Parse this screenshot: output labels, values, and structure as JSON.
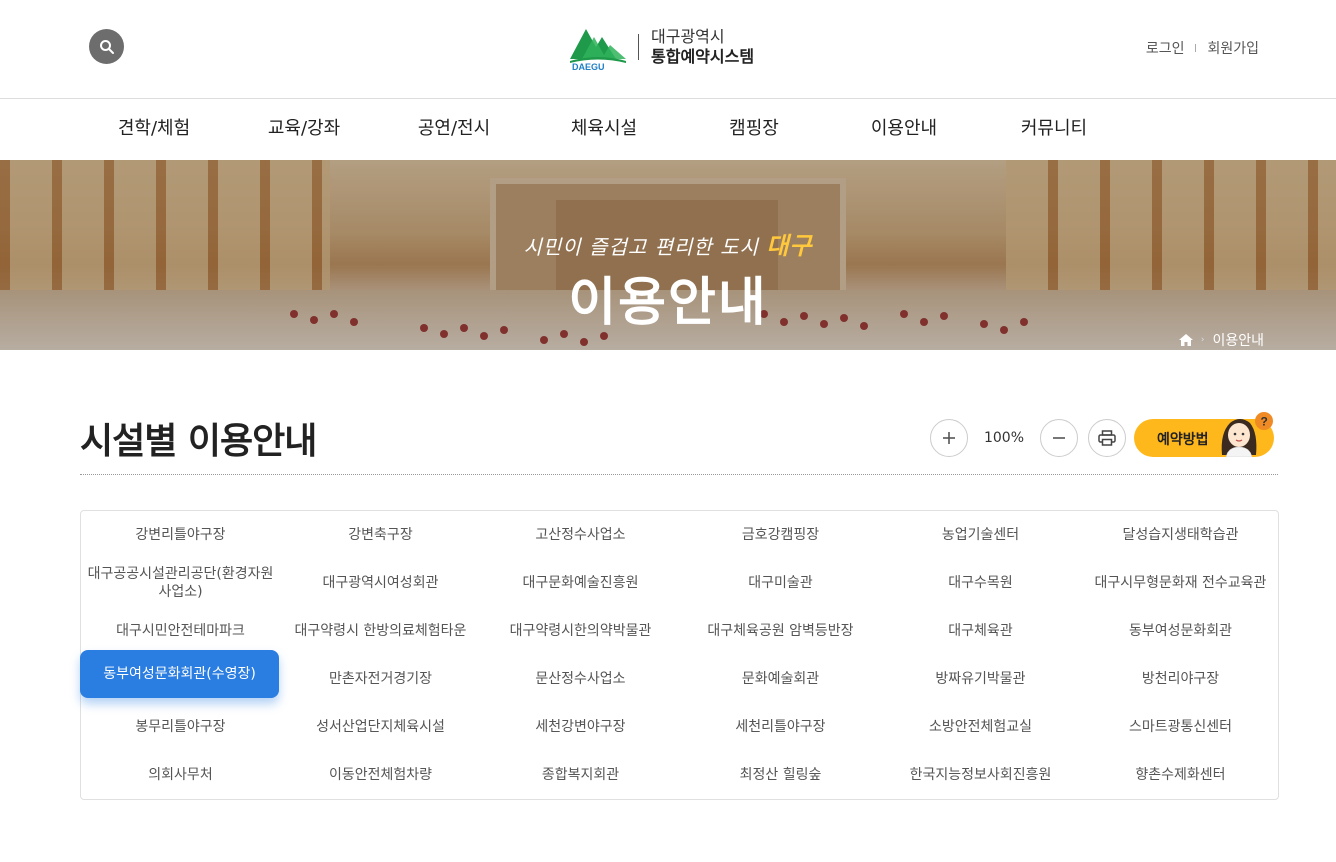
{
  "header": {
    "logo_small": "DAEGU",
    "logo_line1": "대구광역시",
    "logo_line2": "통합예약시스템",
    "login": "로그인",
    "join": "회원가입"
  },
  "gnb": [
    {
      "label": "견학/체험"
    },
    {
      "label": "교육/강좌"
    },
    {
      "label": "공연/전시"
    },
    {
      "label": "체육시설"
    },
    {
      "label": "캠핑장"
    },
    {
      "label": "이용안내"
    },
    {
      "label": "커뮤니티"
    }
  ],
  "visual": {
    "subtitle": "시민이 즐겁고 편리한 도시",
    "subtitle_accent": "대구",
    "title": "이용안내",
    "breadcrumb_current": "이용안내"
  },
  "content": {
    "title": "시설별 이용안내",
    "zoom": "100%",
    "guide_button": "예약방법"
  },
  "facilities": [
    [
      "강변리틀야구장",
      "강변축구장",
      "고산정수사업소",
      "금호강캠핑장",
      "농업기술센터",
      "달성습지생태학습관"
    ],
    [
      "대구공공시설관리공단(환경자원사업소)",
      "대구광역시여성회관",
      "대구문화예술진흥원",
      "대구미술관",
      "대구수목원",
      "대구시무형문화재 전수교육관"
    ],
    [
      "대구시민안전테마파크",
      "대구약령시 한방의료체험타운",
      "대구약령시한의약박물관",
      "대구체육공원 암벽등반장",
      "대구체육관",
      "동부여성문화회관"
    ],
    [
      "동부여성문화회관(수영장)",
      "만촌자전거경기장",
      "문산정수사업소",
      "문화예술회관",
      "방짜유기박물관",
      "방천리야구장"
    ],
    [
      "봉무리틀야구장",
      "성서산업단지체육시설",
      "세천강변야구장",
      "세천리틀야구장",
      "소방안전체험교실",
      "스마트광통신센터"
    ],
    [
      "의회사무처",
      "이동안전체험차량",
      "종합복지회관",
      "최정산 힐링숲",
      "한국지능정보사회진흥원",
      "향촌수제화센터"
    ]
  ],
  "active_facility": "동부여성문화회관(수영장)",
  "colors": {
    "accent_blue": "#2a7de1",
    "accent_yellow": "#ffb81c",
    "logo_green": "#1f9a4a"
  }
}
